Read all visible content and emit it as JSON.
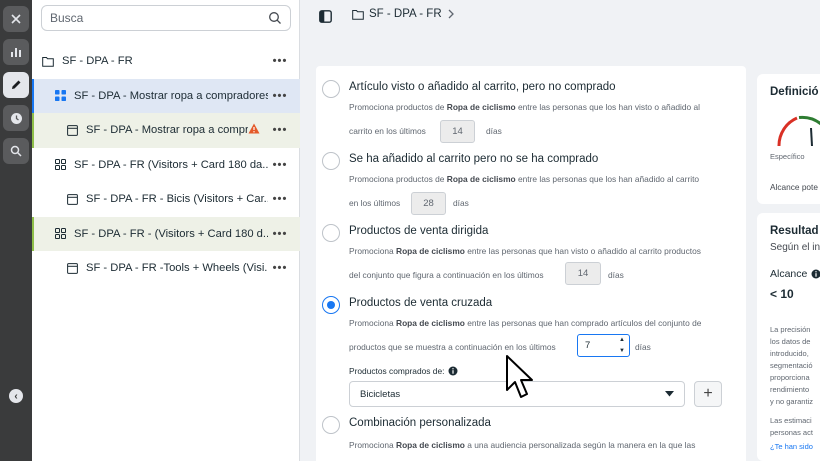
{
  "search": {
    "placeholder": "Busca"
  },
  "breadcrumb": {
    "label": "SF - DPA - FR"
  },
  "tree": [
    {
      "label": "SF - DPA - FR",
      "type": "campaign"
    },
    {
      "label": "SF - DPA - Mostrar ropa a compradores ...",
      "type": "adset"
    },
    {
      "label": "SF - DPA - Mostrar ropa a compr...",
      "type": "ad"
    },
    {
      "label": "SF - DPA - FR (Visitors + Card 180 da...",
      "type": "adset"
    },
    {
      "label": "SF - DPA - FR - Bicis (Visitors + Car...",
      "type": "ad"
    },
    {
      "label": "SF - DPA - FR - (Visitors + Card 180 d...",
      "type": "adset"
    },
    {
      "label": "SF - DPA - FR -Tools + Wheels (Visi...",
      "type": "ad"
    }
  ],
  "options": [
    {
      "title": "Artículo visto o añadido al carrito, pero no comprado",
      "desc_pre": "Promociona productos de ",
      "desc_bold": "Ropa de ciclismo",
      "desc_post": " entre las personas que los han visto o añadido al",
      "desc2": "carrito en los últimos",
      "days": "14",
      "unit": "días"
    },
    {
      "title": "Se ha añadido al carrito pero no se ha comprado",
      "desc_pre": "Promociona productos de ",
      "desc_bold": "Ropa de ciclismo",
      "desc_post": " entre las personas que los han añadido al carrito",
      "desc2": "en los últimos",
      "days": "28",
      "unit": "días"
    },
    {
      "title": "Productos de venta dirigida",
      "desc_pre": "Promociona ",
      "desc_bold": "Ropa de ciclismo",
      "desc_post": " entre las personas que han visto o añadido al carrito productos",
      "desc2": "del conjunto que figura a continuación en los últimos",
      "days": "14",
      "unit": "días"
    },
    {
      "title": "Productos de venta cruzada",
      "desc_pre": "Promociona ",
      "desc_bold": "Ropa de ciclismo",
      "desc_post": " entre las personas que han comprado artículos del conjunto de",
      "desc2": "productos que se muestra a continuación en los últimos",
      "days": "7",
      "unit": "días",
      "selected": true
    },
    {
      "title": "Combinación personalizada",
      "desc_pre": "Promociona ",
      "desc_bold": "Ropa de ciclismo",
      "desc_post": " a una audiencia personalizada según la manera en la que las"
    }
  ],
  "purchased": {
    "label": "Productos comprados de:",
    "value": "Bicicletas"
  },
  "right_panel": {
    "definition_title": "Definició",
    "gauge_label": "Específico",
    "reach_label": "Alcance pote",
    "results_title": "Resultad",
    "results_sub": "Según el in",
    "alcance_label": "Alcance",
    "alcance_value": "< 10",
    "note_lines": [
      "La precisión",
      "los datos de",
      "introducido,",
      "segmentació",
      "proporciona",
      "rendimiento",
      "y no garantiz"
    ],
    "note2_lines": [
      "Las estimaci",
      "personas act"
    ],
    "link": "¿Te han sido"
  },
  "colors": {
    "accent": "#1877f2",
    "warning": "#e45a2a",
    "rail": "#3a3b3c"
  }
}
